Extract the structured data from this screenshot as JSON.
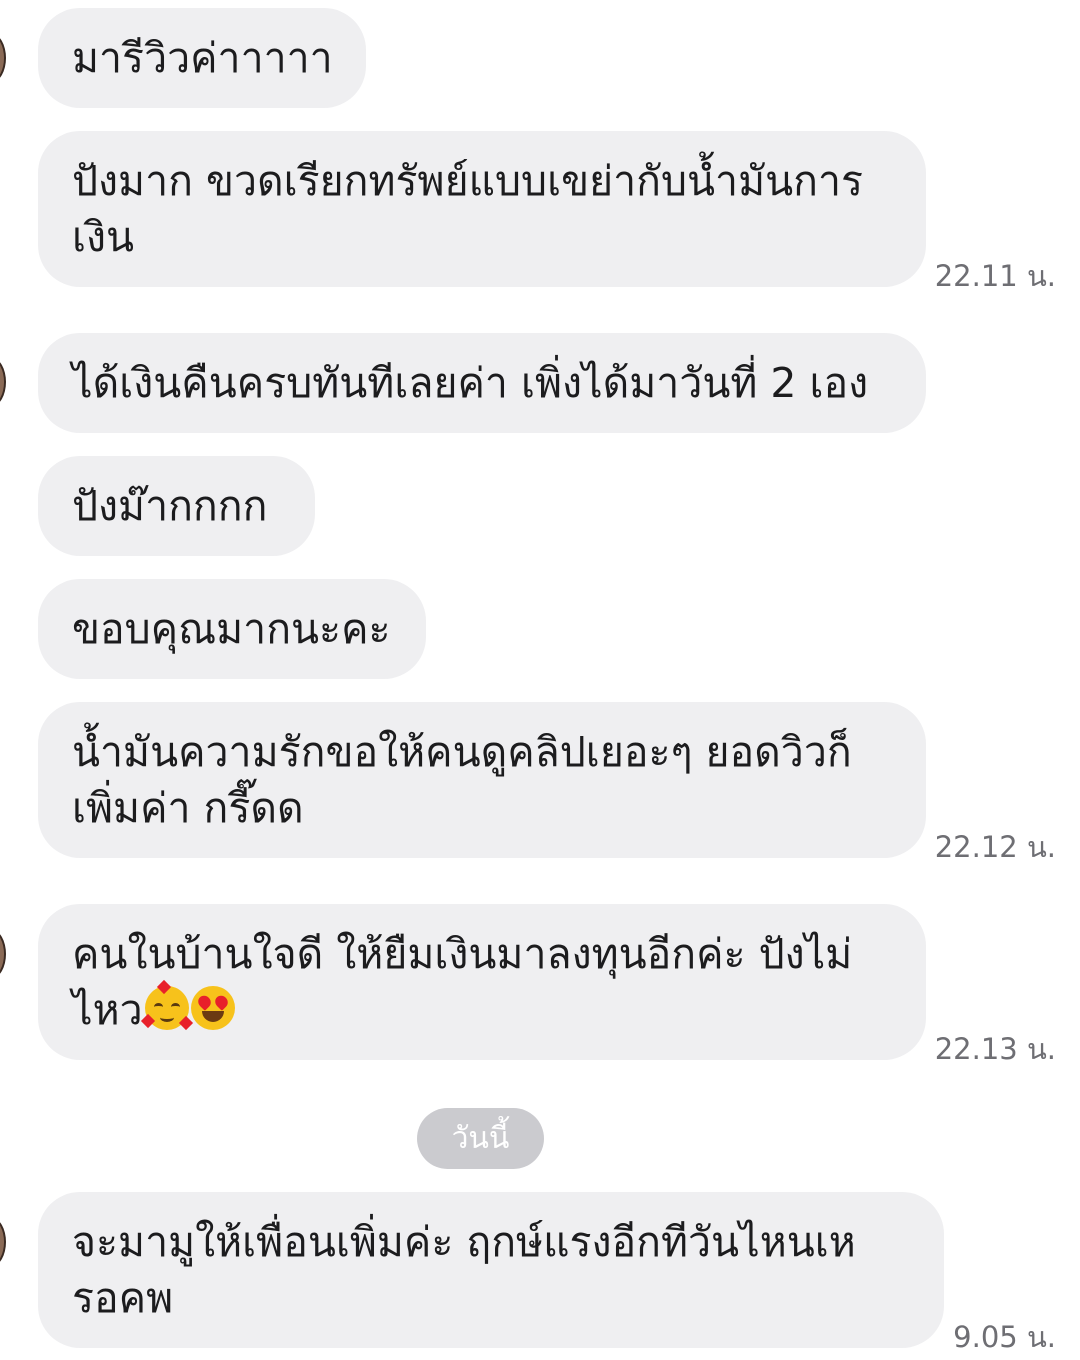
{
  "chat": {
    "messages": [
      {
        "text": "มารีวิวค่าาาาา"
      },
      {
        "text": "ปังมาก ขวดเรียกทรัพย์แบบเขย่ากับน้ำมันการเงิน",
        "time": "22.11 น."
      },
      {
        "text": "ได้เงินคืนครบทันทีเลยค่า เพิ่งได้มาวันที่ 2 เอง"
      },
      {
        "text": "ปังม๊ากกกก"
      },
      {
        "text": "ขอบคุณมากนะคะ"
      },
      {
        "text": "น้ำมันความรักขอให้คนดูคลิปเยอะๆ ยอดวิวก็เพิ่มค่า กรี๊ดด",
        "time": "22.12 น."
      },
      {
        "text": "คนในบ้านใจดี ให้ยืมเงินมาลงทุนอีกค่ะ ปังไม่ไหว",
        "emojis": [
          "smiling-face-with-hearts",
          "heart-eyes"
        ],
        "time": "22.13 น."
      },
      {
        "text": "จะมามูให้เพื่อนเพิ่มค่ะ ฤกษ์แรงอีกทีวันไหนเหรอคพ",
        "time": "9.05 น."
      }
    ],
    "date_separator": "วันนี้"
  }
}
